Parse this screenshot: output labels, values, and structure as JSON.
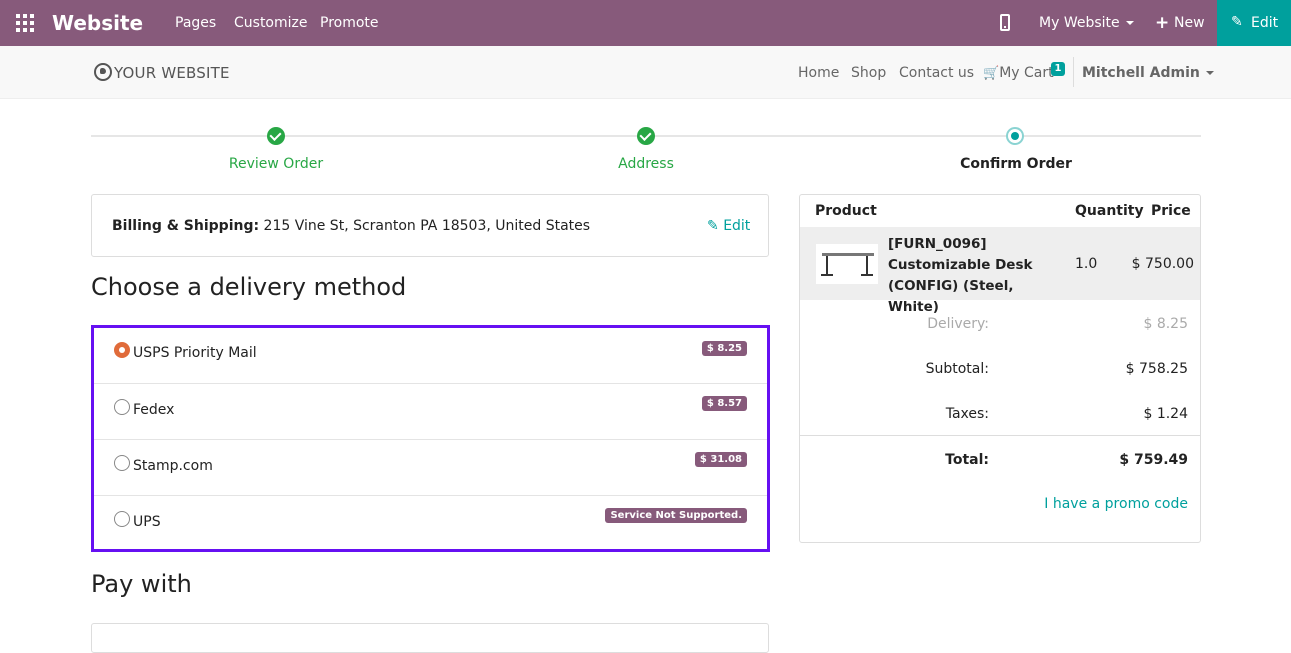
{
  "admin_bar": {
    "app_name": "Website",
    "menu": [
      "Pages",
      "Customize",
      "Promote"
    ],
    "website_selector": "My Website",
    "new_label": "New",
    "edit_label": "Edit",
    "icons": [
      "apps-icon",
      "mobile-preview-icon",
      "plus-icon",
      "pencil-icon"
    ]
  },
  "site_header": {
    "logo_text": "YOUR WEBSITE",
    "nav": [
      "Home",
      "Shop",
      "Contact us"
    ],
    "cart_label": "My Cart",
    "cart_count": "1",
    "user_name": "Mitchell Admin"
  },
  "wizard": {
    "steps": [
      {
        "label": "Review Order",
        "state": "done"
      },
      {
        "label": "Address",
        "state": "done"
      },
      {
        "label": "Confirm Order",
        "state": "current"
      }
    ]
  },
  "billing": {
    "label": "Billing & Shipping:",
    "address": " 215 Vine St, Scranton PA 18503, United States",
    "edit_label": "Edit"
  },
  "delivery": {
    "heading": "Choose a delivery method",
    "carriers": [
      {
        "name": "USPS Priority Mail",
        "badge": "$ 8.25",
        "checked": true
      },
      {
        "name": "Fedex",
        "badge": "$ 8.57",
        "checked": false
      },
      {
        "name": "Stamp.com",
        "badge": "$ 31.08",
        "checked": false
      },
      {
        "name": "UPS",
        "badge": "Service Not Supported.",
        "checked": false
      }
    ]
  },
  "payment": {
    "heading": "Pay with"
  },
  "summary": {
    "headers": {
      "product": "Product",
      "quantity": "Quantity",
      "price": "Price"
    },
    "line": {
      "name": "[FURN_0096] Customizable Desk (CONFIG) (Steel, White)",
      "quantity": "1.0",
      "price": "$ 750.00"
    },
    "delivery_label": "Delivery:",
    "delivery_value": "$ 8.25",
    "subtotal_label": "Subtotal:",
    "subtotal_value": "$ 758.25",
    "taxes_label": "Taxes:",
    "taxes_value": "$ 1.24",
    "total_label": "Total:",
    "total_value": "$ 759.49",
    "promo_label": "I have a promo code"
  },
  "colors": {
    "admin_bar": "#875a7b",
    "accent": "#00a09d",
    "success": "#28a745",
    "delivery_highlight": "#6610f2",
    "selected_radio": "#e06b3a"
  }
}
